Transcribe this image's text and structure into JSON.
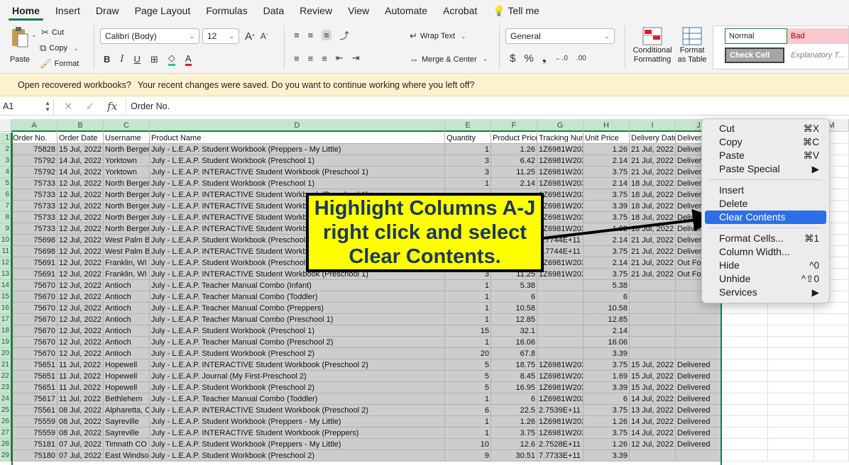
{
  "ribbon": {
    "tabs": [
      "Home",
      "Insert",
      "Draw",
      "Page Layout",
      "Formulas",
      "Data",
      "Review",
      "View",
      "Automate",
      "Acrobat",
      "Tell me"
    ],
    "clipboard": {
      "paste": "Paste",
      "cut": "Cut",
      "copy": "Copy",
      "format": "Format"
    },
    "font": {
      "name": "Calibri (Body)",
      "size": "12"
    },
    "alignment": {
      "wrap": "Wrap Text",
      "merge": "Merge & Center"
    },
    "number": {
      "format": "General"
    },
    "styles": {
      "conditional_line1": "Conditional",
      "conditional_line2": "Formatting",
      "format_table_line1": "Format",
      "format_table_line2": "as Table",
      "normal": "Normal",
      "bad": "Bad",
      "check_cell": "Check Cell",
      "explanatory": "Explanatory T..."
    }
  },
  "infobar": {
    "title": "Open recovered workbooks?",
    "message": "Your recent changes were saved. Do you want to continue working where you left off?"
  },
  "formula_bar": {
    "cell": "A1",
    "value": "Order No."
  },
  "columns": [
    "A",
    "B",
    "C",
    "D",
    "E",
    "F",
    "G",
    "H",
    "I",
    "J",
    "",
    "M"
  ],
  "headers": [
    "Order No.",
    "Order Date",
    "Username",
    "Product Name",
    "Quantity",
    "Product Price",
    "Tracking Nur",
    "Unit Price",
    "Delivery Date",
    "Delivered"
  ],
  "rows": [
    [
      "75828",
      "15 Jul, 2022",
      "North Berger",
      "July - L.E.A.P. Student Workbook (Preppers - My Little)",
      "1",
      "1.26",
      "1Z6981W203",
      "1.26",
      "21 Jul, 2022",
      "Delivered"
    ],
    [
      "75792",
      "14 Jul, 2022",
      "Yorktown",
      "July - L.E.A.P. Student Workbook (Preschool 1)",
      "3",
      "6.42",
      "1Z6981W203",
      "2.14",
      "21 Jul, 2022",
      "Delivered"
    ],
    [
      "75792",
      "14 Jul, 2022",
      "Yorktown",
      "July - L.E.A.P. INTERACTIVE Student Workbook (Preschool 1)",
      "3",
      "11.25",
      "1Z6981W203",
      "3.75",
      "21 Jul, 2022",
      "Delivered"
    ],
    [
      "75733",
      "12 Jul, 2022",
      "North Berger",
      "July - L.E.A.P. Student Workbook (Preschool 1)",
      "1",
      "2.14",
      "1Z6981W203",
      "2.14",
      "18 Jul, 2022",
      "Delivered"
    ],
    [
      "75733",
      "12 Jul, 2022",
      "North Berger",
      "July - L.E.A.P. INTERACTIVE Student Workbook (Preschool 1)",
      "",
      "",
      "1Z6981W203",
      "3.75",
      "18 Jul, 2022",
      "Delivered"
    ],
    [
      "75733",
      "12 Jul, 2022",
      "North Berger",
      "July - L.E.A.P. INTERACTIVE Student Workbook (Preschool 2)",
      "",
      "",
      "1Z6981W203",
      "3.39",
      "18 Jul, 2022",
      "Delivered"
    ],
    [
      "75733",
      "12 Jul, 2022",
      "North Berger",
      "July - L.E.A.P. INTERACTIVE Student Workbook (Preschool 1)",
      "",
      "",
      "1Z6981W203",
      "3.75",
      "18 Jul, 2022",
      "Delivered"
    ],
    [
      "75733",
      "12 Jul, 2022",
      "North Berger",
      "July - L.E.A.P. INTERACTIVE Student Workbook (Preschool 1)",
      "",
      "",
      "1Z6981W203",
      "1.92",
      "18 Jul, 2022",
      "Delivered"
    ],
    [
      "75698",
      "12 Jul, 2022",
      "West Palm B",
      "July - L.E.A.P. Student Workbook (Preschool 1)",
      "",
      "",
      "7.7744E+11",
      "2.14",
      "21 Jul, 2022",
      "Delivered"
    ],
    [
      "75698",
      "12 Jul, 2022",
      "West Palm B",
      "July - L.E.A.P. INTERACTIVE Student Workbook (Preschool 1)",
      "",
      "",
      "7.7744E+11",
      "3.75",
      "21 Jul, 2022",
      "Delivered"
    ],
    [
      "75691",
      "12 Jul, 2022",
      "Franklin, WI",
      "July - L.E.A.P. Student Workbook (Preschool 1)",
      "",
      "",
      "1Z6981W203",
      "2.14",
      "21 Jul, 2022",
      "Out For"
    ],
    [
      "75691",
      "12 Jul, 2022",
      "Franklin, WI",
      "July - L.E.A.P. INTERACTIVE Student Workbook (Preschool 1)",
      "3",
      "11.25",
      "1Z6981W203",
      "3.75",
      "21 Jul, 2022",
      "Out For"
    ],
    [
      "75670",
      "12 Jul, 2022",
      "Antioch",
      "July - L.E.A.P. Teacher Manual Combo (Infant)",
      "1",
      "5.38",
      "",
      "5.38",
      "",
      ""
    ],
    [
      "75670",
      "12 Jul, 2022",
      "Antioch",
      "July - L.E.A.P. Teacher Manual Combo (Toddler)",
      "1",
      "6",
      "",
      "6",
      "",
      ""
    ],
    [
      "75670",
      "12 Jul, 2022",
      "Antioch",
      "July - L.E.A.P. Teacher Manual Combo (Preppers)",
      "1",
      "10.58",
      "",
      "10.58",
      "",
      ""
    ],
    [
      "75670",
      "12 Jul, 2022",
      "Antioch",
      "July - L.E.A.P. Teacher Manual Combo (Preschool 1)",
      "1",
      "12.85",
      "",
      "12.85",
      "",
      ""
    ],
    [
      "75670",
      "12 Jul, 2022",
      "Antioch",
      "July - L.E.A.P. Student Workbook (Preschool 1)",
      "15",
      "32.1",
      "",
      "2.14",
      "",
      ""
    ],
    [
      "75670",
      "12 Jul, 2022",
      "Antioch",
      "July - L.E.A.P. Teacher Manual Combo (Preschool 2)",
      "1",
      "16.06",
      "",
      "16.06",
      "",
      ""
    ],
    [
      "75670",
      "12 Jul, 2022",
      "Antioch",
      "July - L.E.A.P. Student Workbook (Preschool 2)",
      "20",
      "67.8",
      "",
      "3.39",
      "",
      ""
    ],
    [
      "75651",
      "11 Jul, 2022",
      "Hopewell",
      "July - L.E.A.P. INTERACTIVE Student Workbook (Preschool 2)",
      "5",
      "18.75",
      "1Z6981W203",
      "3.75",
      "15 Jul, 2022",
      "Delivered"
    ],
    [
      "75651",
      "11 Jul, 2022",
      "Hopewell",
      "July - L.E.A.P. Journal (My First-Preschool 2)",
      "5",
      "8.45",
      "1Z6981W203",
      "1.69",
      "15 Jul, 2022",
      "Delivered"
    ],
    [
      "75651",
      "11 Jul, 2022",
      "Hopewell",
      "July - L.E.A.P. Student Workbook (Preschool 2)",
      "5",
      "16.95",
      "1Z6981W203",
      "3.39",
      "15 Jul, 2022",
      "Delivered"
    ],
    [
      "75617",
      "11 Jul, 2022",
      "Bethlehem",
      "July - L.E.A.P. Teacher Manual Combo (Toddler)",
      "1",
      "6",
      "1Z6981W203",
      "6",
      "14 Jul, 2022",
      "Delivered"
    ],
    [
      "75561",
      "08 Jul, 2022",
      "Alpharetta, C",
      "July - L.E.A.P. INTERACTIVE Student Workbook (Preschool 2)",
      "6",
      "22.5",
      "2.7539E+11",
      "3.75",
      "13 Jul, 2022",
      "Delivered"
    ],
    [
      "75559",
      "08 Jul, 2022",
      "Sayreville",
      "July - L.E.A.P. Student Workbook (Preppers - My Little)",
      "1",
      "1.26",
      "1Z6981W203",
      "1.26",
      "14 Jul, 2022",
      "Delivered"
    ],
    [
      "75559",
      "08 Jul, 2022",
      "Sayreville",
      "July - L.E.A.P. INTERACTIVE Student Workbook (Preppers)",
      "1",
      "3.75",
      "1Z6981W203",
      "3.75",
      "14 Jul, 2022",
      "Delivered"
    ],
    [
      "75181",
      "07 Jul, 2022",
      "Timnath CO",
      "July - L.E.A.P. Student Workbook (Preppers - My Little)",
      "10",
      "12.6",
      "2.7528E+11",
      "1.26",
      "12 Jul, 2022",
      "Delivered"
    ],
    [
      "75180",
      "07 Jul, 2022",
      "East Windso",
      "July - L.E.A.P. Student Workbook (Preschool 2)",
      "9",
      "30.51",
      "7.7733E+11",
      "3.39",
      "",
      ""
    ]
  ],
  "context_menu": {
    "items": [
      {
        "label": "Cut",
        "shortcut": "⌘X"
      },
      {
        "label": "Copy",
        "shortcut": "⌘C"
      },
      {
        "label": "Paste",
        "shortcut": "⌘V"
      },
      {
        "label": "Paste Special",
        "shortcut": "▶"
      },
      {
        "label": "Insert",
        "shortcut": ""
      },
      {
        "label": "Delete",
        "shortcut": ""
      },
      {
        "label": "Clear Contents",
        "shortcut": ""
      },
      {
        "label": "Format Cells...",
        "shortcut": "⌘1"
      },
      {
        "label": "Column Width...",
        "shortcut": ""
      },
      {
        "label": "Hide",
        "shortcut": "^0"
      },
      {
        "label": "Unhide",
        "shortcut": "^⇧0"
      },
      {
        "label": "Services",
        "shortcut": "▶"
      }
    ],
    "highlighted": "Clear Contents"
  },
  "callout": {
    "line1": "Highlight Columns A-J",
    "line2": "right click and select",
    "line3": "Clear Contents."
  },
  "colors": {
    "accent": "#1d7a45",
    "selection_fill": "#cdcdcd",
    "menu_highlight": "#2d6fe6",
    "callout_fill": "#ffff00",
    "callout_text": "#1c3760"
  }
}
